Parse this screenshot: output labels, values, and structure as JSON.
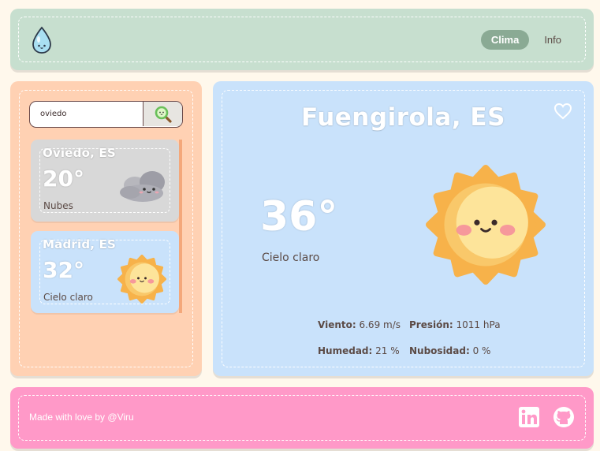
{
  "app": {
    "logo_icon": "water-drop-icon",
    "nav": [
      {
        "label": "Clima",
        "active": true
      },
      {
        "label": "Info",
        "active": false
      }
    ]
  },
  "search": {
    "value": "oviedo",
    "button_icon": "magnifier-icon"
  },
  "cities": [
    {
      "city": "Oviedo, ES",
      "temp": "20°",
      "desc": "Nubes",
      "icon": "cloud-icon",
      "color": "#d8d8d8"
    },
    {
      "city": "Madrid, ES",
      "temp": "32°",
      "desc": "Cielo claro",
      "icon": "sun-icon",
      "color": "#c9e2fb"
    }
  ],
  "current": {
    "city": "Fuengirola, ES",
    "temp": "36°",
    "desc": "Cielo claro",
    "icon": "sun-icon",
    "favorite_icon": "heart-icon",
    "stats": {
      "wind_label": "Viento:",
      "wind_value": "6.69 m/s",
      "pressure_label": "Presión:",
      "pressure_value": "1011 hPa",
      "humidity_label": "Humedad:",
      "humidity_value": "21 %",
      "cloudiness_label": "Nubosidad:",
      "cloudiness_value": "0 %"
    }
  },
  "footer": {
    "credit": "Made with love by @Viru",
    "links": [
      "linkedin-icon",
      "github-icon"
    ]
  },
  "colors": {
    "header": "#c7dfcf",
    "sidebar": "#ffd1b3",
    "main": "#c9e2fb",
    "footer": "#ff99c8",
    "accent": "#8aaa94",
    "sun": "#f7b24a"
  }
}
